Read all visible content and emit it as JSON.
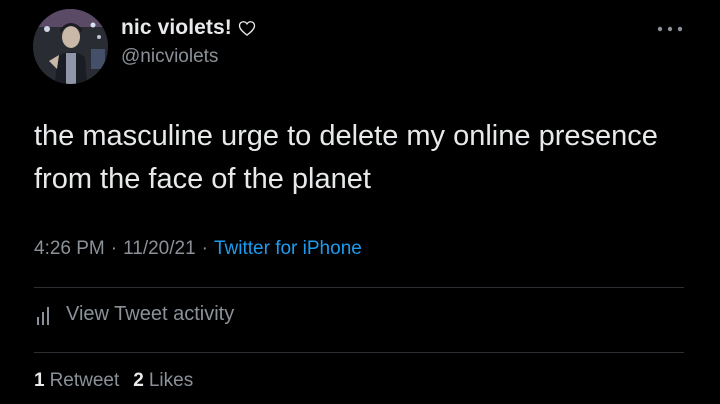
{
  "author": {
    "display_name": "nic violets!",
    "handle": "@nicviolets"
  },
  "tweet": {
    "text": "the masculine urge to delete my online presence from the face of the planet",
    "time": "4:26 PM",
    "date": "11/20/21",
    "separator": "·",
    "source": "Twitter for iPhone"
  },
  "activity": {
    "label": "View Tweet activity"
  },
  "stats": {
    "retweets_count": "1",
    "retweets_label": "Retweet",
    "likes_count": "2",
    "likes_label": "Likes"
  },
  "icons": {
    "heart": "heart-outline-icon",
    "more": "more-icon",
    "activity": "bar-chart-icon"
  },
  "colors": {
    "background": "#000000",
    "primary_text": "#e7e9ea",
    "secondary_text": "#8b9198",
    "link": "#1d9bf0",
    "divider": "#2b2f33"
  }
}
